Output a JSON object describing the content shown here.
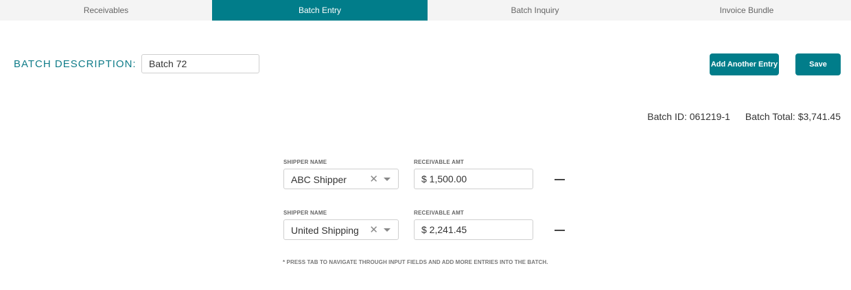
{
  "tabs": [
    {
      "label": "Receivables",
      "active": false
    },
    {
      "label": "Batch Entry",
      "active": true
    },
    {
      "label": "Batch Inquiry",
      "active": false
    },
    {
      "label": "Invoice Bundle",
      "active": false
    }
  ],
  "batch": {
    "description_label": "BATCH DESCRIPTION:",
    "description_value": "Batch 72",
    "id_text": "Batch ID: 061219-1",
    "total_text": "Batch Total: $3,741.45"
  },
  "actions": {
    "add_label": "Add Another Entry",
    "save_label": "Save"
  },
  "entries": [
    {
      "shipper_label": "SHIPPER NAME",
      "shipper_value": "ABC Shipper",
      "amount_label": "RECEIVABLE AMT",
      "amount_value": "$ 1,500.00"
    },
    {
      "shipper_label": "SHIPPER NAME",
      "shipper_value": "United Shipping",
      "amount_label": "RECEIVABLE AMT",
      "amount_value": "$ 2,241.45"
    }
  ],
  "note": "* PRESS TAB TO NAVIGATE THROUGH INPUT FIELDS AND ADD MORE ENTRIES INTO THE BATCH.",
  "icons": {
    "clear": "clear-x-icon",
    "dropdown": "caret-down-icon",
    "remove": "minus-icon"
  },
  "colors": {
    "accent": "#017d8a",
    "tab_bg": "#f4f4f4"
  }
}
